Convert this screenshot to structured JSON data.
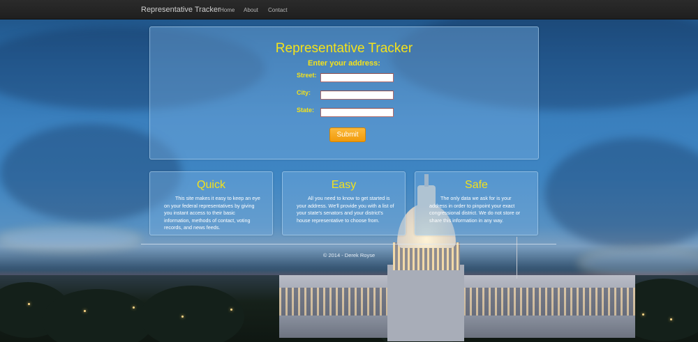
{
  "nav": {
    "brand": "Representative Tracker",
    "links": [
      "Home",
      "About",
      "Contact"
    ]
  },
  "hero": {
    "title": "Representative Tracker",
    "subtitle": "Enter your address:",
    "fields": [
      {
        "label": "Street:",
        "value": ""
      },
      {
        "label": "City:",
        "value": ""
      },
      {
        "label": "State:",
        "value": ""
      }
    ],
    "submit_label": "Submit"
  },
  "cards": [
    {
      "title": "Quick",
      "text": "This site makes it easy to keep an eye on your federal representatives by giving you instant access to their basic information, methods of contact, voting records, and news feeds."
    },
    {
      "title": "Easy",
      "text": "All you need to know to get started is your address. We'll provide you with a list of your state's senators and your district's house representative to choose from."
    },
    {
      "title": "Safe",
      "text": "The only data we ask for is your address in order to pinpoint your exact congressional district. We do not store or share this information in any way."
    }
  ],
  "footer": "© 2014 - Derek Royse",
  "colors": {
    "accent_yellow": "#f4e21a",
    "submit_orange": "#f19a0a",
    "navbar": "#222222"
  }
}
